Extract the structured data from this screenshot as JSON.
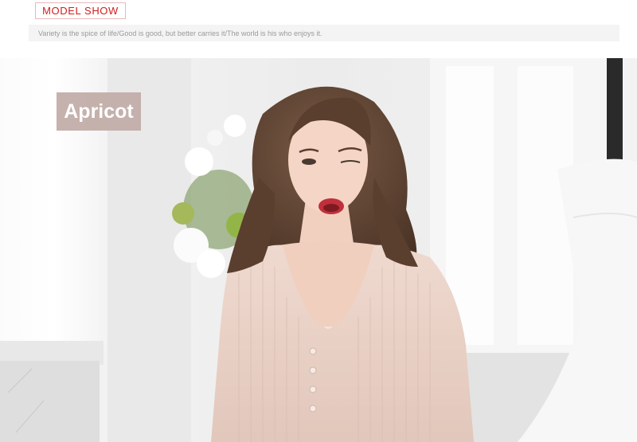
{
  "header": {
    "tag_label": "MODEL SHOW",
    "tagline": "Variety is the spice of life/Good is good, but better carries it/The world is his who enjoys it."
  },
  "photo": {
    "color_label": "Apricot",
    "description": "model-in-ribbed-knit-top"
  },
  "colors": {
    "accent": "#d41b1b",
    "badge": "#c3aea9",
    "garment": "#ead2c7"
  }
}
